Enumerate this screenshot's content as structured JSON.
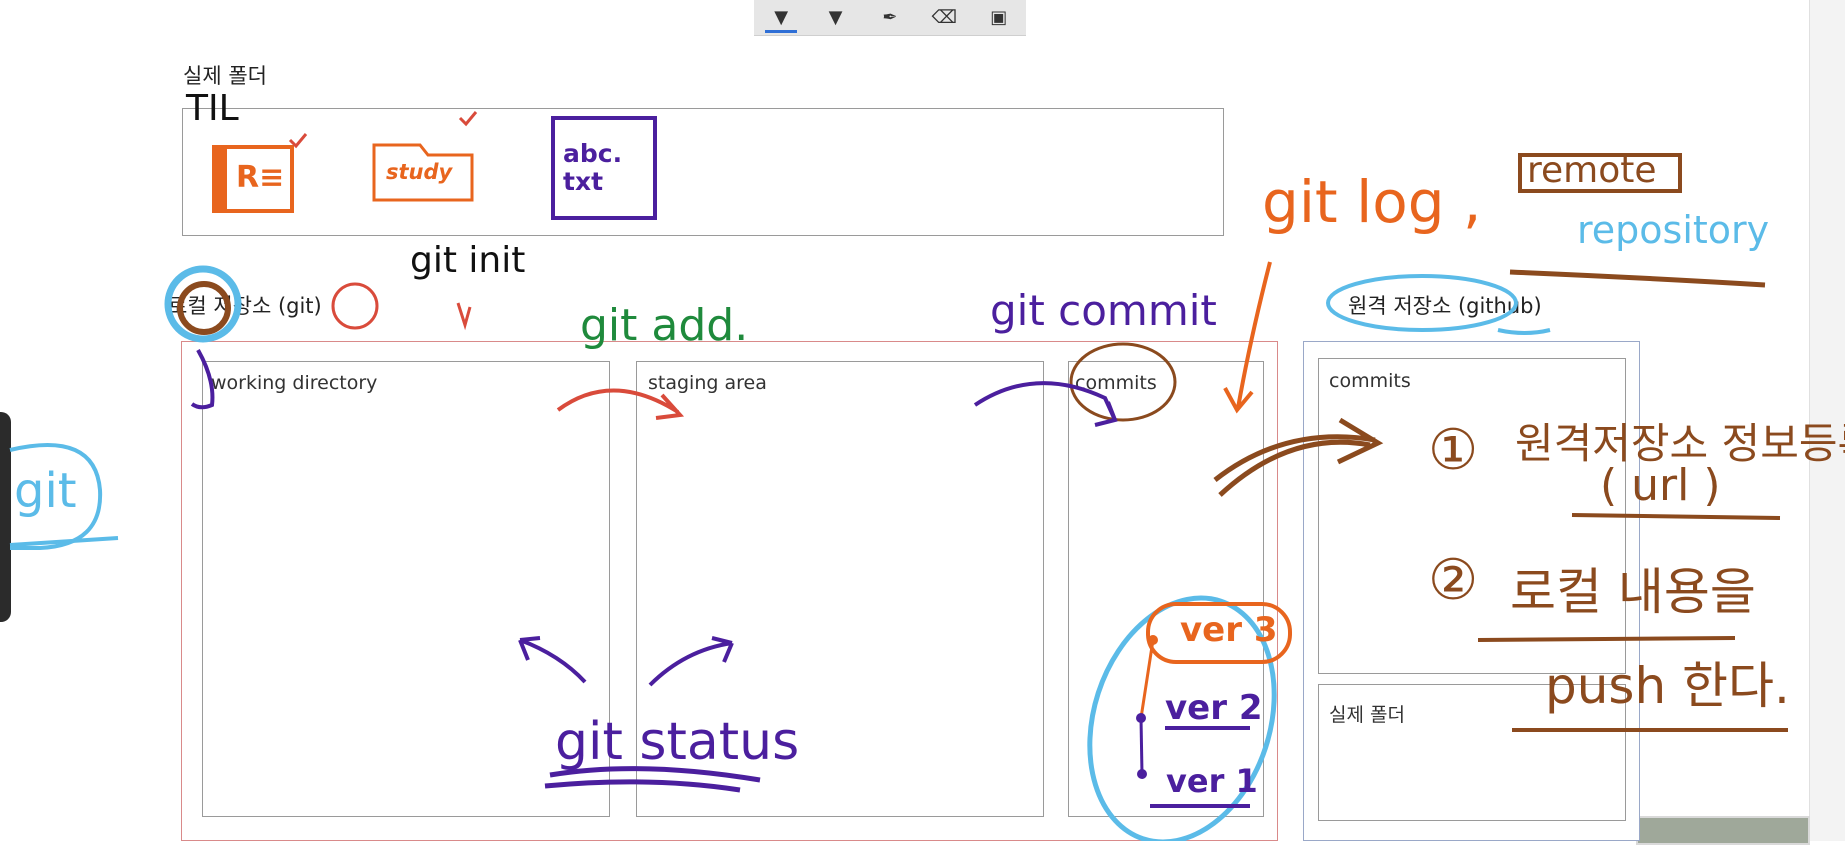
{
  "toolbar": {
    "tools": [
      {
        "icon": "pen-icon",
        "glyph": "▼",
        "active": true
      },
      {
        "icon": "highlighter-icon",
        "glyph": "▼",
        "active": false
      },
      {
        "icon": "pen-nib-icon",
        "glyph": "✒",
        "active": false
      },
      {
        "icon": "eraser-icon",
        "glyph": "⌫",
        "active": false
      },
      {
        "icon": "save-icon",
        "glyph": "▣",
        "active": false
      }
    ]
  },
  "diagram": {
    "real_folder_title": "실제 폴더",
    "local_repo_title": "로컬 저장소 (git)",
    "local_panels": {
      "working_directory": "working directory",
      "staging_area": "staging area",
      "commits": "commits"
    },
    "remote_repo_title": "원격 저장소 (github)",
    "remote_panels": {
      "commits": "commits",
      "real_folder": "실제 폴더"
    }
  },
  "handwriting": {
    "til": "TIL",
    "readme_file": "R≡",
    "study_folder": "study",
    "abc_file": "abc. txt",
    "git_side": "git",
    "git_init": "git init",
    "git_add": "git add.",
    "git_commit": "git commit",
    "git_log": "git log ,",
    "remote": "remote",
    "repository": "repository",
    "git_status": "git status",
    "ver3": "ver 3",
    "ver2": "ver 2",
    "ver1": "ver 1",
    "note1_num": "①",
    "note1": "원격저장소 정보등록",
    "note1_sub": "( url )",
    "note2_num": "②",
    "note2": "로컬 내용을",
    "note2_sub": "push 한다."
  },
  "colors": {
    "orange": "#e8651e",
    "brown": "#8b4a1e",
    "purple": "#4b1f9e",
    "green": "#1f8a3c",
    "skyblue": "#5bbbe8",
    "red": "#d94b3b",
    "black": "#111111",
    "local_border": "#d98a8a",
    "remote_border": "#9aa8c8"
  }
}
